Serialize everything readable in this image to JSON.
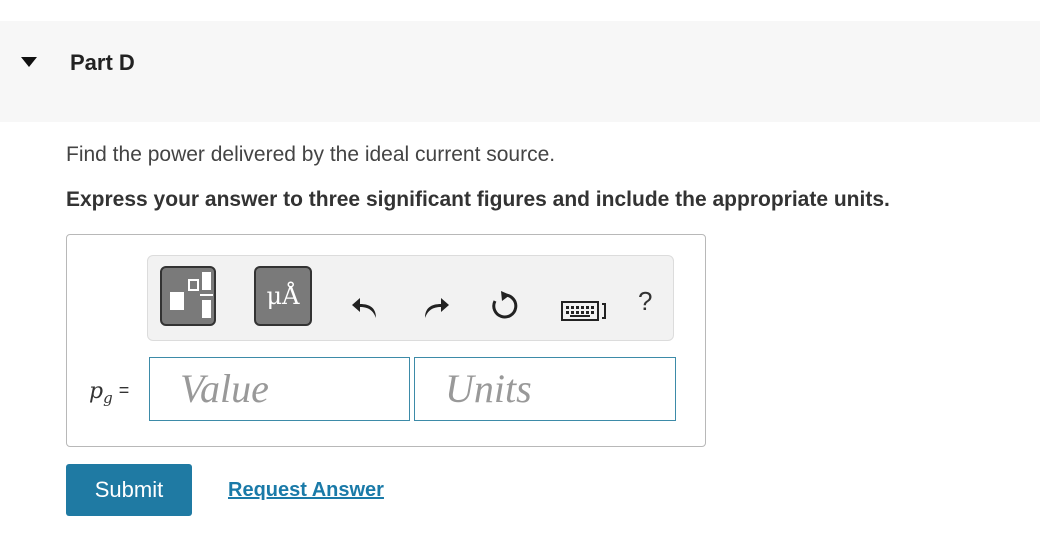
{
  "part": {
    "title": "Part D",
    "expanded": true
  },
  "question": {
    "text": "Find the power delivered by the ideal current source.",
    "instruction": "Express your answer to three significant figures and include the appropriate units."
  },
  "toolbar": {
    "units_button_label": "μÅ",
    "help_label": "?",
    "icons": [
      "templates-icon",
      "units-icon",
      "undo-icon",
      "redo-icon",
      "reset-icon",
      "keyboard-icon",
      "help-icon"
    ]
  },
  "answer": {
    "variable": "p",
    "variable_subscript": "g",
    "equals": "=",
    "value_placeholder": "Value",
    "units_placeholder": "Units"
  },
  "actions": {
    "submit_label": "Submit",
    "request_answer_label": "Request Answer"
  },
  "colors": {
    "accent": "#1f7aa3",
    "link": "#1a7aa8",
    "field_border": "#3d8ba8",
    "header_bg": "#f7f7f7"
  }
}
